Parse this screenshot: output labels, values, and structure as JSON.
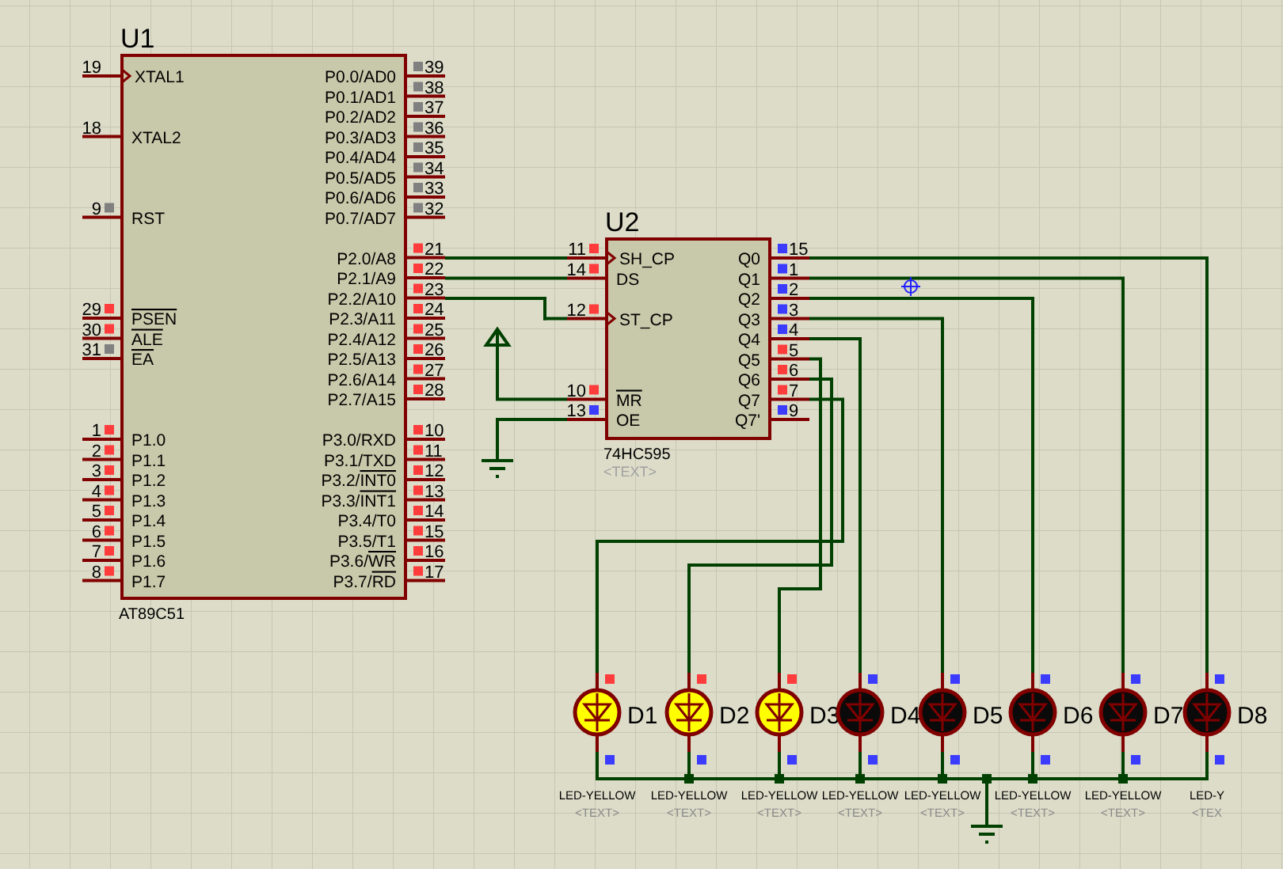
{
  "components": [
    {
      "kind": "mcu",
      "ref": "U1",
      "part": "AT89C51",
      "pins_left": [
        {
          "num": "19",
          "name": "XTAL1",
          "clock": true
        },
        {
          "num": "18",
          "name": "XTAL2"
        },
        {
          "num": "9",
          "name": "RST",
          "color": "#808080"
        },
        {
          "num": "29",
          "bar": "PSEN",
          "color": "#ff3c3c"
        },
        {
          "num": "30",
          "bar": "ALE",
          "color": "#ff3c3c"
        },
        {
          "num": "31",
          "bar": "EA",
          "color": "#808080"
        },
        {
          "num": "1",
          "name": "P1.0",
          "color": "#ff3c3c"
        },
        {
          "num": "2",
          "name": "P1.1",
          "color": "#ff3c3c"
        },
        {
          "num": "3",
          "name": "P1.2",
          "color": "#ff3c3c"
        },
        {
          "num": "4",
          "name": "P1.3",
          "color": "#ff3c3c"
        },
        {
          "num": "5",
          "name": "P1.4",
          "color": "#ff3c3c"
        },
        {
          "num": "6",
          "name": "P1.5",
          "color": "#ff3c3c"
        },
        {
          "num": "7",
          "name": "P1.6",
          "color": "#ff3c3c"
        },
        {
          "num": "8",
          "name": "P1.7",
          "color": "#ff3c3c"
        }
      ],
      "pins_right": [
        {
          "num": "39",
          "name": "P0.0/AD0",
          "color": "#808080"
        },
        {
          "num": "38",
          "name": "P0.1/AD1",
          "color": "#808080"
        },
        {
          "num": "37",
          "name": "P0.2/AD2",
          "color": "#808080"
        },
        {
          "num": "36",
          "name": "P0.3/AD3",
          "color": "#808080"
        },
        {
          "num": "35",
          "name": "P0.4/AD4",
          "color": "#808080"
        },
        {
          "num": "34",
          "name": "P0.5/AD5",
          "color": "#808080"
        },
        {
          "num": "33",
          "name": "P0.6/AD6",
          "color": "#808080"
        },
        {
          "num": "32",
          "name": "P0.7/AD7",
          "color": "#808080"
        },
        {
          "num": "21",
          "name": "P2.0/A8",
          "color": "#ff3c3c"
        },
        {
          "num": "22",
          "name": "P2.1/A9",
          "color": "#ff3c3c"
        },
        {
          "num": "23",
          "name": "P2.2/A10",
          "color": "#ff3c3c"
        },
        {
          "num": "24",
          "name": "P2.3/A11",
          "color": "#ff3c3c"
        },
        {
          "num": "25",
          "name": "P2.4/A12",
          "color": "#ff3c3c"
        },
        {
          "num": "26",
          "name": "P2.5/A13",
          "color": "#ff3c3c"
        },
        {
          "num": "27",
          "name": "P2.6/A14",
          "color": "#ff3c3c"
        },
        {
          "num": "28",
          "name": "P2.7/A15",
          "color": "#ff3c3c"
        },
        {
          "num": "10",
          "name": "P3.0/RXD",
          "color": "#ff3c3c"
        },
        {
          "num": "11",
          "name": "P3.1/TXD",
          "color": "#ff3c3c"
        },
        {
          "num": "12",
          "name": "P3.2/",
          "bar": "INT0",
          "color": "#ff3c3c"
        },
        {
          "num": "13",
          "name": "P3.3/",
          "bar": "INT1",
          "color": "#ff3c3c"
        },
        {
          "num": "14",
          "name": "P3.4/T0",
          "color": "#ff3c3c"
        },
        {
          "num": "15",
          "name": "P3.5/T1",
          "color": "#ff3c3c"
        },
        {
          "num": "16",
          "name": "P3.6/",
          "bar": "WR",
          "color": "#ff3c3c"
        },
        {
          "num": "17",
          "name": "P3.7/",
          "bar": "RD",
          "color": "#ff3c3c"
        }
      ]
    },
    {
      "kind": "ic",
      "ref": "U2",
      "part": "74HC595",
      "text": "<TEXT>",
      "pins_left": [
        {
          "num": "11",
          "name": "SH_CP",
          "clock": true,
          "color": "#ff3c3c"
        },
        {
          "num": "14",
          "name": "DS",
          "color": "#ff3c3c"
        },
        {
          "num": "12",
          "name": "ST_CP",
          "clock": true,
          "color": "#ff3c3c"
        },
        {
          "num": "10",
          "bar": "MR",
          "color": "#ff3c3c"
        },
        {
          "num": "13",
          "name": "OE",
          "color": "#3c3cff"
        }
      ],
      "pins_right": [
        {
          "num": "15",
          "name": "Q0",
          "color": "#3c3cff"
        },
        {
          "num": "1",
          "name": "Q1",
          "color": "#3c3cff"
        },
        {
          "num": "2",
          "name": "Q2",
          "color": "#3c3cff"
        },
        {
          "num": "3",
          "name": "Q3",
          "color": "#3c3cff"
        },
        {
          "num": "4",
          "name": "Q4",
          "color": "#3c3cff"
        },
        {
          "num": "5",
          "name": "Q5",
          "color": "#ff3c3c"
        },
        {
          "num": "6",
          "name": "Q6",
          "color": "#ff3c3c"
        },
        {
          "num": "7",
          "name": "Q7",
          "color": "#ff3c3c"
        },
        {
          "num": "9",
          "name": "Q7'",
          "color": "#3c3cff"
        }
      ]
    }
  ],
  "leds": [
    {
      "ref": "D1",
      "part": "LED-YELLOW",
      "text": "<TEXT>",
      "lit": true,
      "anode": {
        "color": "#ff3c3c"
      },
      "cathode": {
        "color": "#3c3cff"
      }
    },
    {
      "ref": "D2",
      "part": "LED-YELLOW",
      "text": "<TEXT>",
      "lit": true,
      "anode": {
        "color": "#ff3c3c"
      },
      "cathode": {
        "color": "#3c3cff"
      }
    },
    {
      "ref": "D3",
      "part": "LED-YELLOW",
      "text": "<TEXT>",
      "lit": true,
      "anode": {
        "color": "#ff3c3c"
      },
      "cathode": {
        "color": "#3c3cff"
      }
    },
    {
      "ref": "D4",
      "part": "LED-YELLOW",
      "text": "<TEXT>",
      "lit": false,
      "anode": {
        "color": "#3c3cff"
      },
      "cathode": {
        "color": "#3c3cff"
      }
    },
    {
      "ref": "D5",
      "part": "LED-YELLOW",
      "text": "<TEXT>",
      "lit": false,
      "anode": {
        "color": "#3c3cff"
      },
      "cathode": {
        "color": "#3c3cff"
      }
    },
    {
      "ref": "D6",
      "part": "LED-YELLOW",
      "text": "<TEXT>",
      "lit": false,
      "anode": {
        "color": "#3c3cff"
      },
      "cathode": {
        "color": "#3c3cff"
      }
    },
    {
      "ref": "D7",
      "part": "LED-YELLOW",
      "text": "<TEXT>",
      "lit": false,
      "anode": {
        "color": "#3c3cff"
      },
      "cathode": {
        "color": "#3c3cff"
      }
    },
    {
      "ref": "D8",
      "part": "LED-Y",
      "text": "<TEX",
      "lit": false,
      "anode": {
        "color": "#3c3cff"
      },
      "cathode": {
        "color": "#3c3cff"
      }
    }
  ]
}
